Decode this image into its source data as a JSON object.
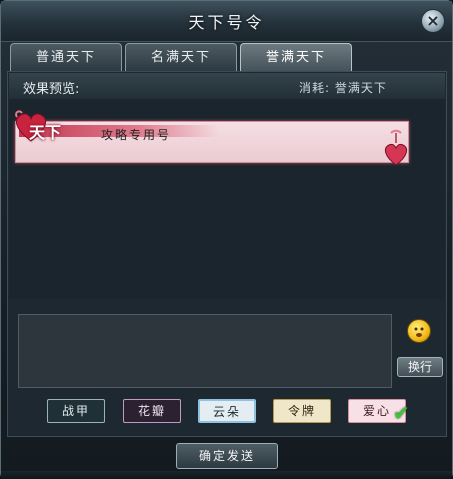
{
  "window": {
    "title": "天下号令",
    "close_symbol": "×"
  },
  "tabs": [
    {
      "label": "普通天下",
      "active": false
    },
    {
      "label": "名满天下",
      "active": false
    },
    {
      "label": "誉满天下",
      "active": true
    }
  ],
  "preview": {
    "label": "效果预览:",
    "cost": "消耗: 誉满天下",
    "banner_logo": "天下",
    "banner_text": "攻略专用号"
  },
  "emoji_icon": "smiley-face-icon",
  "newline_button": "换行",
  "styles": [
    {
      "label": "战甲",
      "selected": false
    },
    {
      "label": "花瓣",
      "selected": false
    },
    {
      "label": "云朵",
      "selected": false
    },
    {
      "label": "令牌",
      "selected": false
    },
    {
      "label": "爱心",
      "selected": true
    }
  ],
  "confirm_button": "确定发送",
  "colors": {
    "accent_pink": "#e07c8e",
    "check_green": "#3bc43a"
  }
}
